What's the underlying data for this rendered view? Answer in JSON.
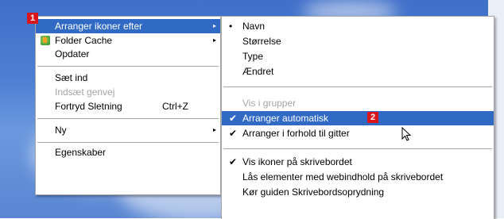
{
  "main_menu": {
    "items": [
      {
        "label": "Arranger ikoner efter",
        "submenu": "▸",
        "badge": "1",
        "highlighted": true
      },
      {
        "label": "Folder Cache",
        "submenu": "▸",
        "icon": "folder-cache-icon"
      },
      {
        "label": "Opdater"
      },
      {
        "label": "Sæt ind"
      },
      {
        "label": "Indsæt genvej",
        "disabled": true
      },
      {
        "label": "Fortryd Sletning",
        "shortcut": "Ctrl+Z"
      },
      {
        "label": "Ny",
        "submenu": "▸"
      },
      {
        "label": "Egenskaber"
      }
    ]
  },
  "sub_menu": {
    "items": [
      {
        "label": "Navn",
        "mark": "•"
      },
      {
        "label": "Størrelse"
      },
      {
        "label": "Type"
      },
      {
        "label": "Ændret"
      },
      {
        "label": "Vis i grupper",
        "disabled": true
      },
      {
        "label": "Arranger automatisk",
        "mark": "✔",
        "badge": "2",
        "highlighted": true
      },
      {
        "label": "Arranger i forhold til gitter",
        "mark": "✔"
      },
      {
        "label": "Vis ikoner på skrivebordet",
        "mark": "✔"
      },
      {
        "label": "Lås elementer med webindhold på skrivebordet"
      },
      {
        "label": "Kør guiden Skrivebordsoprydning"
      }
    ]
  },
  "colors": {
    "highlight": "#316ac5",
    "badge": "#d9161c",
    "desktop": "#4c7fd3"
  }
}
